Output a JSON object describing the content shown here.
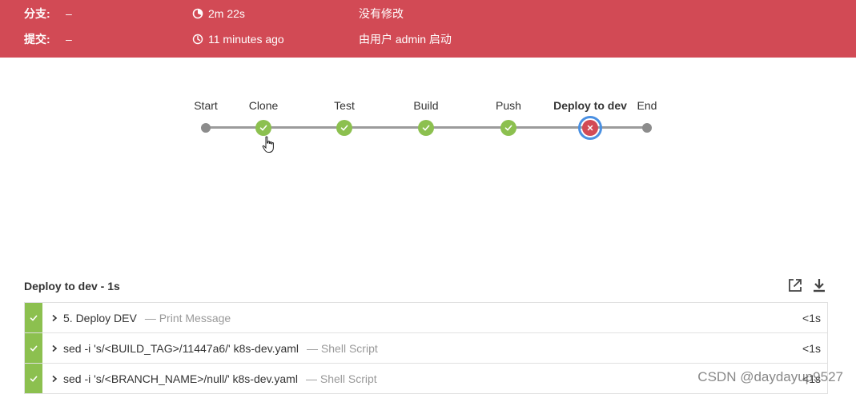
{
  "header": {
    "branch_label": "分支:",
    "branch_value": "–",
    "commit_label": "提交:",
    "commit_value": "–",
    "duration": "2m 22s",
    "started_ago": "11 minutes ago",
    "changes": "没有修改",
    "started_by": "由用户 admin 启动",
    "color": "#d24a55"
  },
  "pipeline": {
    "stages": [
      {
        "label": "Start",
        "state": "start"
      },
      {
        "label": "Clone",
        "state": "success"
      },
      {
        "label": "Test",
        "state": "success"
      },
      {
        "label": "Build",
        "state": "success"
      },
      {
        "label": "Push",
        "state": "success"
      },
      {
        "label": "Deploy to dev",
        "state": "failed",
        "selected": true
      },
      {
        "label": "End",
        "state": "end"
      }
    ],
    "success_color": "#8cc04f",
    "fail_color": "#d24a55",
    "selected_color": "#4a90e2"
  },
  "steps_section": {
    "title": "Deploy to dev - 1s",
    "open_icon": "external-link-icon",
    "download_icon": "download-icon",
    "steps": [
      {
        "name": "5. Deploy DEV",
        "desc": "— Print Message",
        "duration": "<1s"
      },
      {
        "name": "sed -i 's/<BUILD_TAG>/11447a6/' k8s-dev.yaml",
        "desc": "— Shell Script",
        "duration": "<1s"
      },
      {
        "name": "sed -i 's/<BRANCH_NAME>/null/' k8s-dev.yaml",
        "desc": "— Shell Script",
        "duration": "<1s"
      }
    ]
  },
  "watermark": "CSDN @daydayup9527"
}
